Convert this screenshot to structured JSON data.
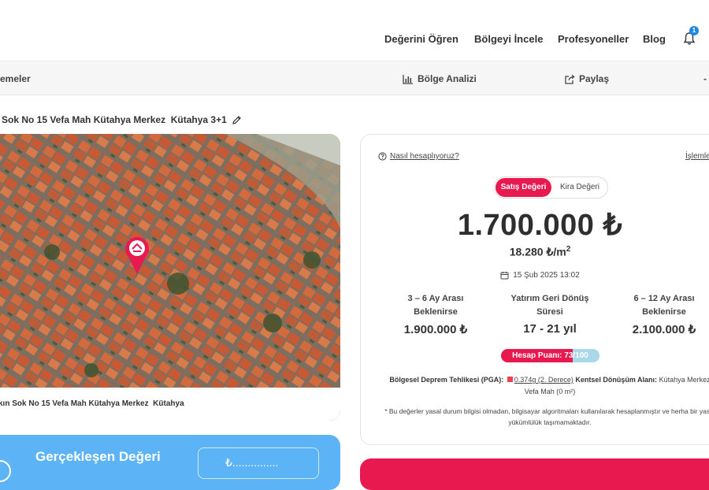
{
  "topnav": {
    "links": [
      "Değerini Öğren",
      "Bölgeyi İncele",
      "Profesyoneller",
      "Blog"
    ],
    "notification_count": "1"
  },
  "subbar": {
    "left_label": "emeler",
    "analysis_label": "Bölge Analizi",
    "share_label": "Paylaş",
    "right_label": "-"
  },
  "address": {
    "text": "Sok No 15 Vefa Mah Kütahya Merkez  Kütahya 3+1"
  },
  "map": {
    "caption": "kın Sok No 15 Vefa Mah Kütahya Merkez  Kütahya"
  },
  "valuation": {
    "how_label": "Nasıl hesaplıyoruz?",
    "actions_label": "İşlemle",
    "toggle": {
      "active": "Satış Değeri",
      "inactive": "Kira Değeri"
    },
    "price": "1.700.000 ₺",
    "per_m2": "18.280 ₺/m",
    "per_m2_sup": "2",
    "date": "15 Şub 2025 13:02",
    "stats": [
      {
        "label_1": "3 – 6 Ay Arası",
        "label_2": "Beklenirse",
        "value": "1.900.000 ₺"
      },
      {
        "label_1": "Yatırım Geri Dönüş",
        "label_2": "Süresi",
        "value": "17 - 21 yıl"
      },
      {
        "label_1": "6 – 12 Ay Arası",
        "label_2": "Beklenirse",
        "value": "2.100.000 ₺"
      }
    ],
    "score_label": "Hesap Puanı: 73/100",
    "score_value": 73,
    "score_max": 100,
    "quake_label": "Bölgesel Deprem Tehlikesi (PGA):",
    "quake_value": "0.374g (2. Derece)",
    "urban_label": "Kentsel Dönüşüm Alanı:",
    "urban_value": "Kütahya Merkez Vefa Mah (0 m²)",
    "disclaimer": "* Bu değerler yasal durum bilgisi olmadan, bilgisayar algoritmaları kullanılarak hesaplanmıştır ve herha bir yasal yükümlülük taşımamaktadır."
  },
  "realized": {
    "title": "Gerçekleşen Değeri",
    "input_placeholder": "₺..............."
  },
  "colors": {
    "accent": "#e8194f",
    "blue": "#5cb3f5",
    "score_track": "#a8d8ea"
  }
}
